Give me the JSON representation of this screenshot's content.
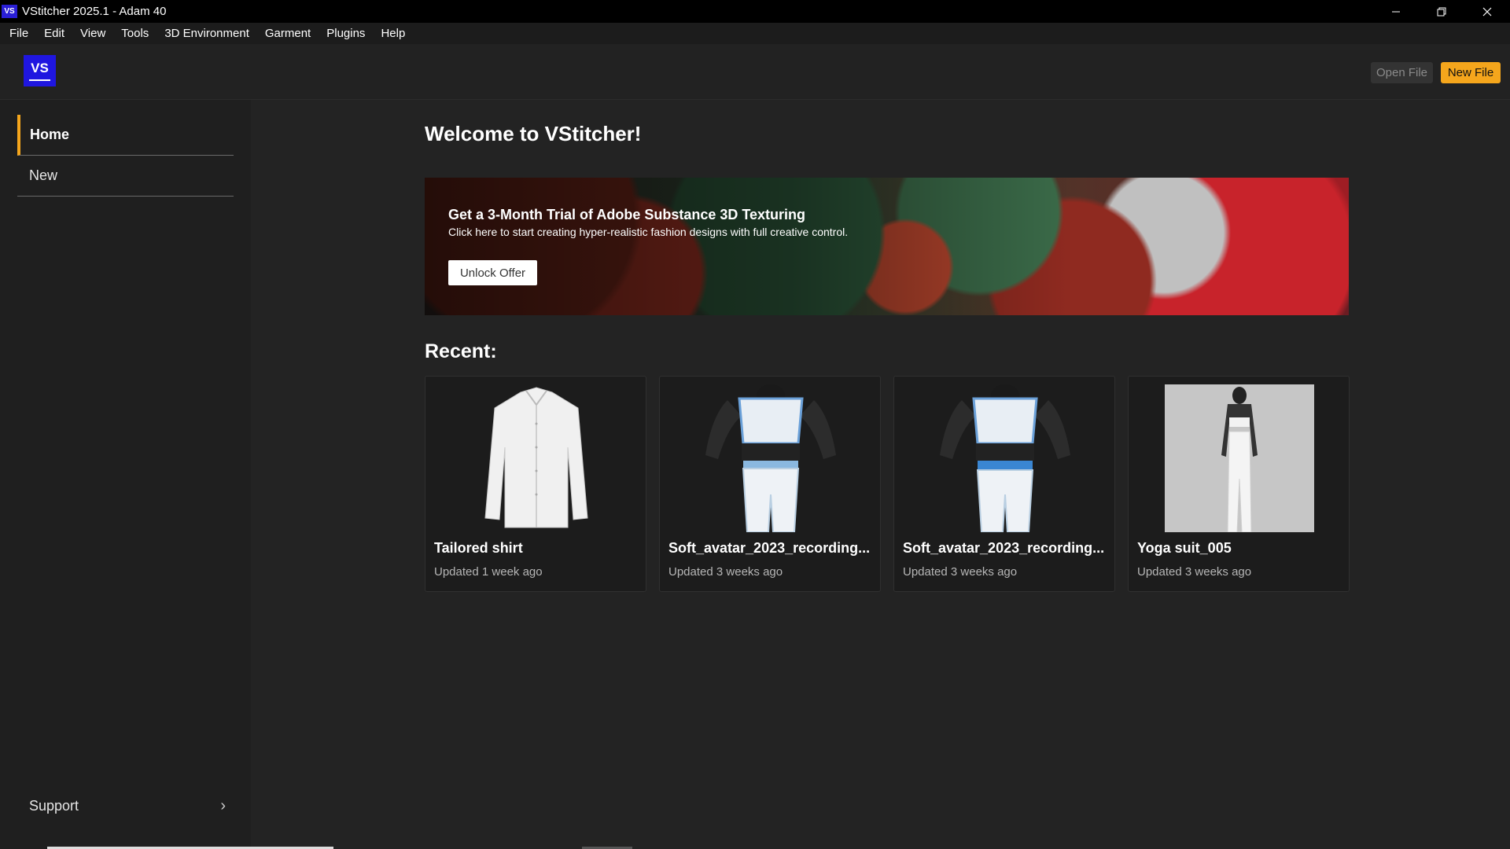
{
  "window": {
    "title": "VStitcher 2025.1 - Adam 40",
    "app_icon": "VS"
  },
  "menu": [
    "File",
    "Edit",
    "View",
    "Tools",
    "3D Environment",
    "Garment",
    "Plugins",
    "Help"
  ],
  "header": {
    "logo": "VS",
    "open_file": "Open File",
    "new_file": "New File",
    "accent_color": "#f5a61c"
  },
  "sidebar": {
    "items": [
      {
        "label": "Home",
        "active": true
      },
      {
        "label": "New",
        "active": false
      }
    ],
    "support": "Support"
  },
  "main": {
    "welcome": "Welcome to VStitcher!",
    "banner": {
      "title": "Get a 3-Month Trial of Adobe Substance 3D Texturing",
      "subtitle": "Click here to start creating hyper-realistic fashion designs with full creative control.",
      "button": "Unlock Offer"
    },
    "recent_label": "Recent:",
    "recent": [
      {
        "name": "Tailored shirt",
        "updated": "Updated 1 week ago",
        "thumb": "shirt-thumbnail"
      },
      {
        "name": "Soft_avatar_2023_recording...",
        "updated": "Updated 3 weeks ago",
        "thumb": "avatar-outfit-thumbnail"
      },
      {
        "name": "Soft_avatar_2023_recording...",
        "updated": "Updated 3 weeks ago",
        "thumb": "avatar-outfit-thumbnail"
      },
      {
        "name": "Yoga suit_005",
        "updated": "Updated 3 weeks ago",
        "thumb": "yoga-suit-thumbnail"
      }
    ]
  }
}
